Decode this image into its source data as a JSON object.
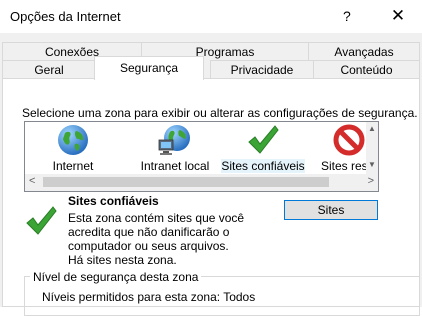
{
  "window": {
    "title": "Opções da Internet",
    "help_label": "?",
    "close_label": "✕"
  },
  "tabs": {
    "row1": [
      "Conexões",
      "Programas",
      "Avançadas"
    ],
    "row2": [
      "Geral",
      "Segurança",
      "Privacidade",
      "Conteúdo"
    ],
    "selected": "Segurança"
  },
  "security": {
    "instruction": "Selecione uma zona para exibir ou alterar as configurações de segurança.",
    "zones": [
      {
        "label": "Internet",
        "icon": "globe-icon"
      },
      {
        "label": "Intranet local",
        "icon": "intranet-icon"
      },
      {
        "label": "Sites confiáveis",
        "icon": "checkmark-icon"
      },
      {
        "label": "Sites res",
        "icon": "restricted-icon"
      }
    ],
    "selected_zone_index": 2,
    "zone_title": "Sites confiáveis",
    "zone_description": [
      "Esta zona contém sites que você",
      "acredita que não danificarão o",
      "computador ou seus arquivos.",
      "Há sites nesta zona."
    ],
    "sites_button": "Sites",
    "level_group_label": "Nível de segurança desta zona",
    "allowed_levels": "Níveis permitidos para esta zona: Todos"
  },
  "colors": {
    "accent": "#0078d7",
    "check_green": "#3aa535",
    "restricted_red": "#d42b2b"
  }
}
